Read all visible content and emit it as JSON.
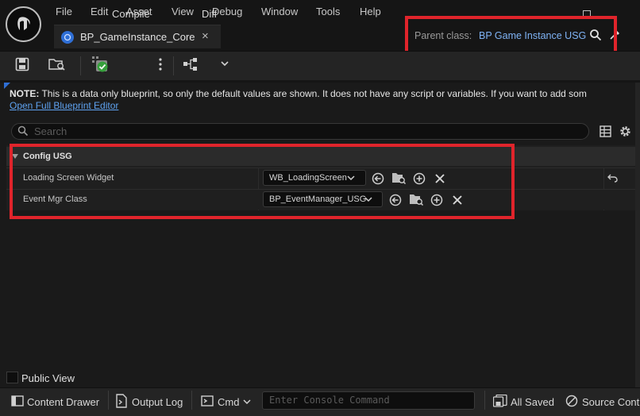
{
  "menu": [
    "File",
    "Edit",
    "Asset",
    "View",
    "Debug",
    "Window",
    "Tools",
    "Help"
  ],
  "tab": {
    "title": "BP_GameInstance_Core",
    "close": "×"
  },
  "parent_class": {
    "label": "Parent class:",
    "value": "BP Game Instance USG"
  },
  "toolbar": {
    "compile": "Compile",
    "diff": "Diff"
  },
  "note": {
    "bold": "NOTE:",
    "text": " This is a data only blueprint, so only the default values are shown.  It does not have any script or variables.  If you want to add som",
    "link": "Open Full Blueprint Editor"
  },
  "search": {
    "placeholder": "Search"
  },
  "details": {
    "category": "Config USG",
    "rows": [
      {
        "label": "Loading Screen Widget",
        "value": "WB_LoadingScreen"
      },
      {
        "label": "Event Mgr Class",
        "value": "BP_EventManager_USG"
      }
    ]
  },
  "public_view": "Public View",
  "status": {
    "content_drawer": "Content Drawer",
    "output_log": "Output Log",
    "cmd": "Cmd",
    "console_placeholder": "Enter Console Command",
    "all_saved": "All Saved",
    "source_control": "Source Cont"
  },
  "colors": {
    "highlight": "#e0242b",
    "link": "#5ea2f0",
    "parent_value": "#7fb3f5"
  }
}
